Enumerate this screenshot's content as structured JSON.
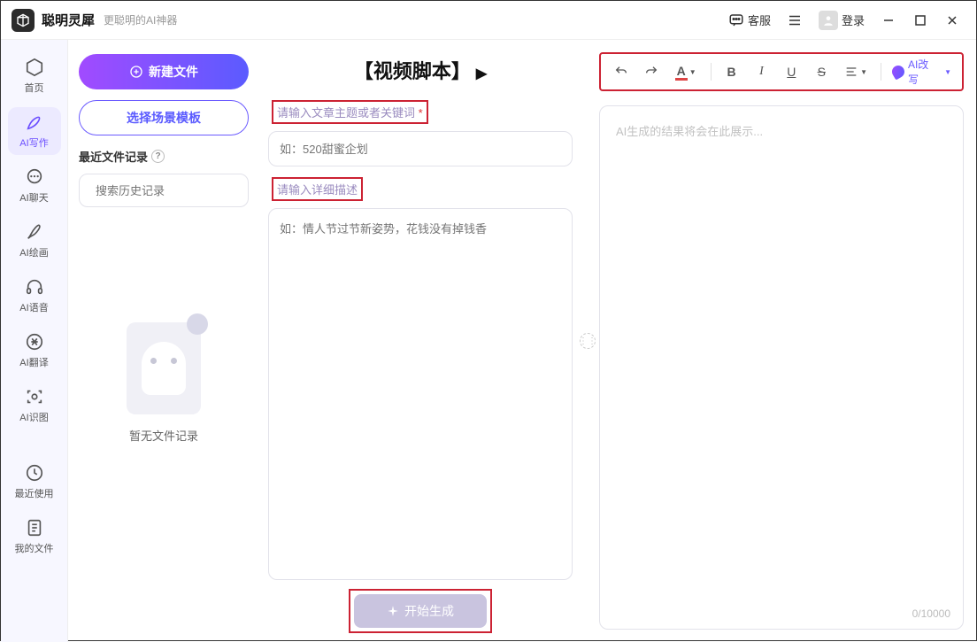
{
  "titlebar": {
    "app_name": "聪明灵犀",
    "subtitle": "更聪明的AI神器",
    "service": "客服",
    "login": "登录"
  },
  "sidebar": {
    "items": [
      {
        "label": "首页"
      },
      {
        "label": "AI写作"
      },
      {
        "label": "AI聊天"
      },
      {
        "label": "AI绘画"
      },
      {
        "label": "AI语音"
      },
      {
        "label": "AI翻译"
      },
      {
        "label": "AI识图"
      },
      {
        "label": "最近使用"
      },
      {
        "label": "我的文件"
      }
    ]
  },
  "left": {
    "new_file": "新建文件",
    "choose_template": "选择场景模板",
    "recent_label": "最近文件记录",
    "search_placeholder": "搜索历史记录",
    "empty_text": "暂无文件记录"
  },
  "mid": {
    "title": "【视频脚本】",
    "topic_label": "请输入文章主题或者关键词",
    "topic_placeholder": "如：520甜蜜企划",
    "detail_label": "请输入详细描述",
    "detail_placeholder": "如：情人节过节新姿势，花钱没有掉钱香",
    "generate": "开始生成"
  },
  "right": {
    "ai_rewrite": "AI改写",
    "result_placeholder": "AI生成的结果将会在此展示...",
    "counter": "0/10000",
    "tools": {
      "font": "A",
      "bold": "B",
      "italic": "I",
      "underline": "U",
      "strike": "S"
    }
  }
}
